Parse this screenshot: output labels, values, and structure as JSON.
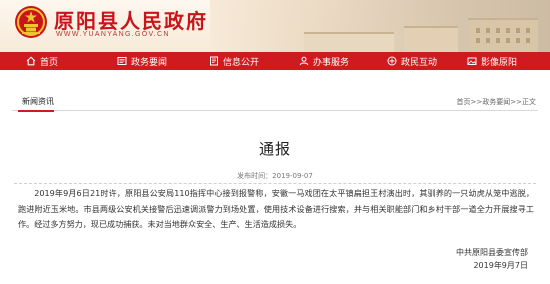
{
  "header": {
    "site_title": "原阳县人民政府",
    "site_url": "WWW.YUANYANG.GOV.CN",
    "brand_red": "#cf1a1f",
    "emblem_icon": "national-emblem-icon"
  },
  "nav": {
    "items": [
      {
        "label": "首页",
        "icon": "home-icon"
      },
      {
        "label": "政务要闻",
        "icon": "news-icon"
      },
      {
        "label": "信息公开",
        "icon": "info-icon"
      },
      {
        "label": "办事服务",
        "icon": "service-icon"
      },
      {
        "label": "政民互动",
        "icon": "interaction-icon"
      },
      {
        "label": "影像原阳",
        "icon": "image-icon"
      }
    ]
  },
  "breadcrumb": {
    "section": "新闻资讯",
    "path_home": "首页",
    "sep1": ">>",
    "path_section": "政务要闻",
    "sep2": ">>",
    "path_current": "正文"
  },
  "article": {
    "title": "通报",
    "date": "发布时间：2019-09-07",
    "body": "2019年9月6日21时许，原阳县公安局110指挥中心接到报警称，安徽一马戏团在太平镇扁担王村演出时，其驯养的一只幼虎从笼中逃脱，跑进附近玉米地。市县两级公安机关接警后迅速调派警力到场处置，使用技术设备进行搜索，并与相关职能部门和乡村干部一道全力开展搜寻工作。经过多方努力，现已成功捕获。未对当地群众安全、生产、生活造成损失。",
    "signer": "中共原阳县委宣传部",
    "sign_date": "2019年9月7日"
  }
}
